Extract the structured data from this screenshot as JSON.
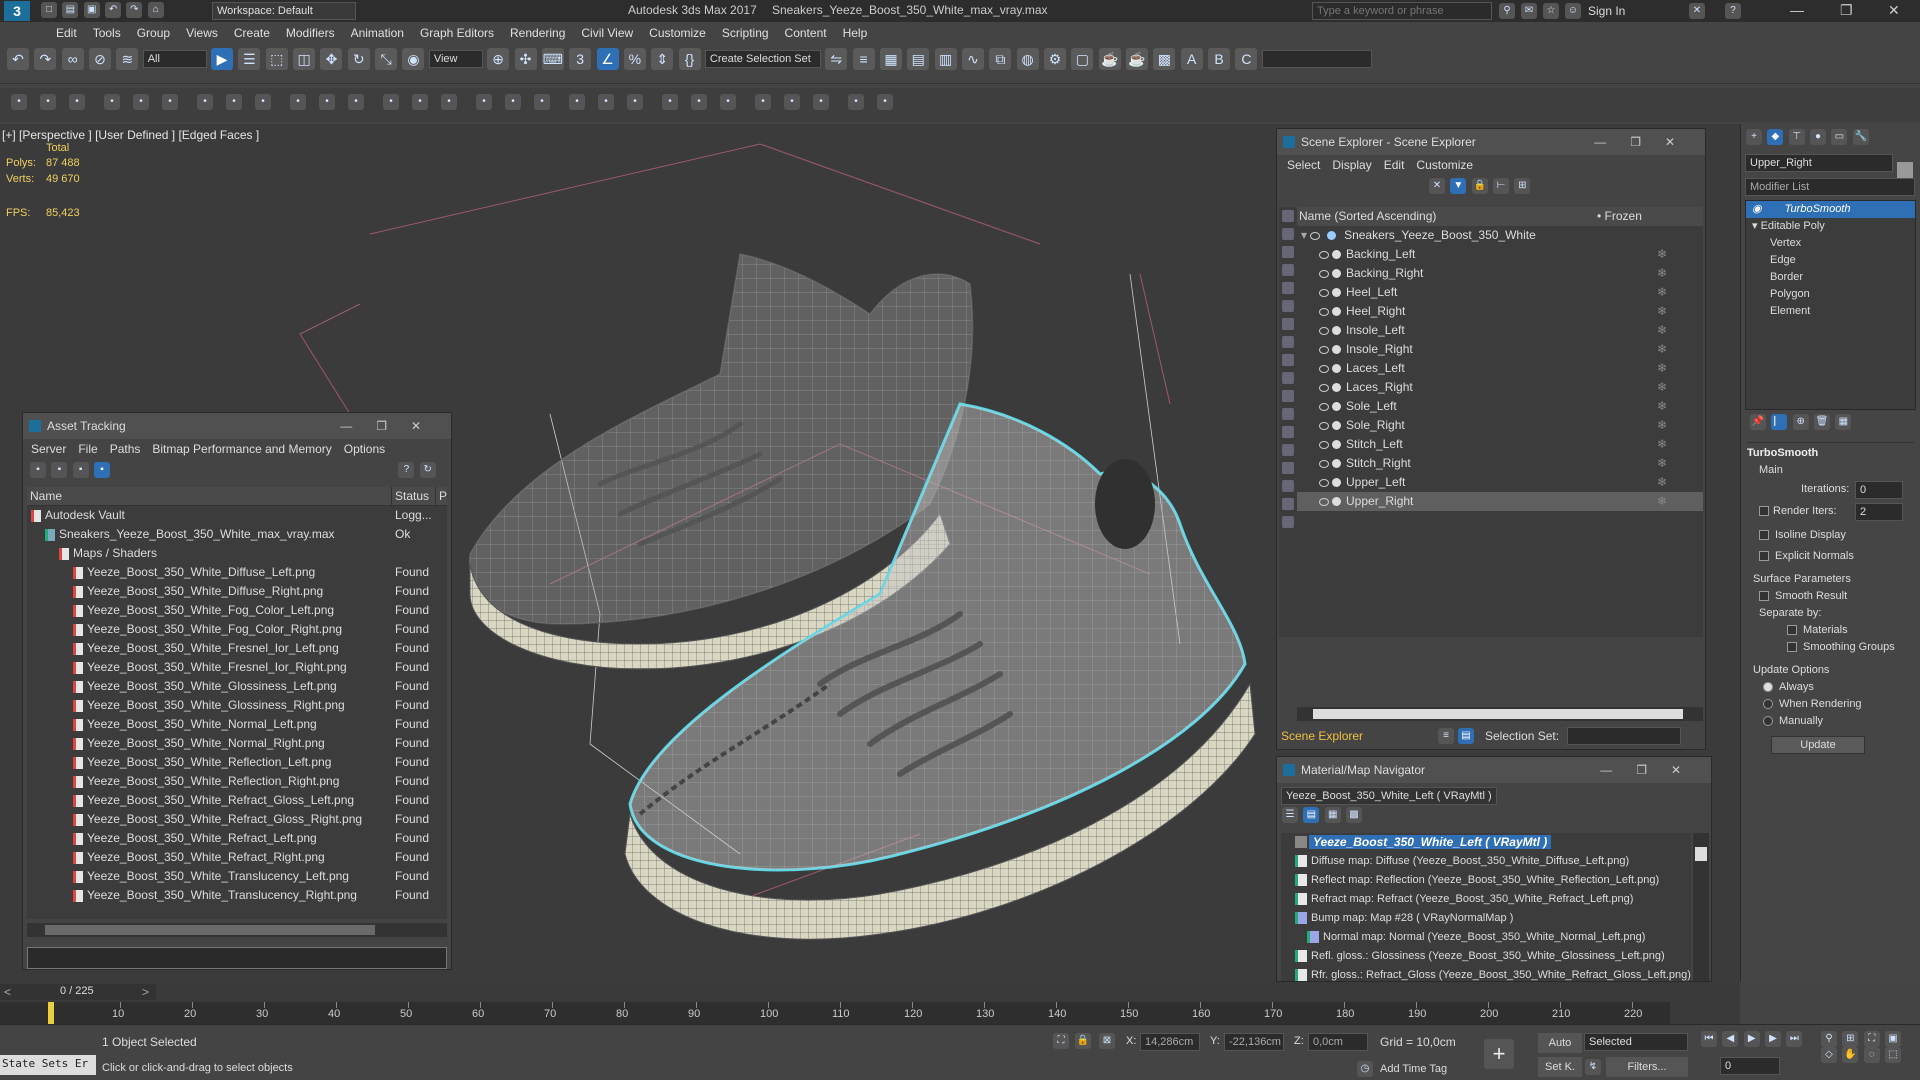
{
  "app": {
    "title": "Autodesk 3ds Max 2017",
    "document": "Sneakers_Yeeze_Boost_350_White_max_vray.max",
    "workspace": "Workspace: Default",
    "search_placeholder": "Type a keyword or phrase",
    "sign_in": "Sign In"
  },
  "menu": [
    "Edit",
    "Tools",
    "Group",
    "Views",
    "Create",
    "Modifiers",
    "Animation",
    "Graph Editors",
    "Rendering",
    "Civil View",
    "Customize",
    "Scripting",
    "Content",
    "Help"
  ],
  "toolbar": {
    "filter_all": "All",
    "view_dropdown": "View",
    "selection_set": "Create Selection Set"
  },
  "viewport": {
    "label_plus": "[+]",
    "label_view": "[Perspective ]",
    "label_shading": "[User Defined ]",
    "label_faces": "[Edged Faces ]",
    "stats_total": "Total",
    "polys_label": "Polys:",
    "polys_value": "87 488",
    "verts_label": "Verts:",
    "verts_value": "49 670",
    "fps_label": "FPS:",
    "fps_value": "85,423"
  },
  "asset_tracking": {
    "title": "Asset Tracking",
    "menu": [
      "Server",
      "File",
      "Paths",
      "Bitmap Performance and Memory",
      "Options"
    ],
    "col_name": "Name",
    "col_status": "Status",
    "col_extra": "Pr",
    "rows": [
      {
        "name": "Autodesk Vault",
        "status": "Logg...",
        "indent": 0
      },
      {
        "name": "Sneakers_Yeeze_Boost_350_White_max_vray.max",
        "status": "Ok",
        "indent": 1
      },
      {
        "name": "Maps / Shaders",
        "status": "",
        "indent": 2
      },
      {
        "name": "Yeeze_Boost_350_White_Diffuse_Left.png",
        "status": "Found",
        "indent": 3
      },
      {
        "name": "Yeeze_Boost_350_White_Diffuse_Right.png",
        "status": "Found",
        "indent": 3
      },
      {
        "name": "Yeeze_Boost_350_White_Fog_Color_Left.png",
        "status": "Found",
        "indent": 3
      },
      {
        "name": "Yeeze_Boost_350_White_Fog_Color_Right.png",
        "status": "Found",
        "indent": 3
      },
      {
        "name": "Yeeze_Boost_350_White_Fresnel_Ior_Left.png",
        "status": "Found",
        "indent": 3
      },
      {
        "name": "Yeeze_Boost_350_White_Fresnel_Ior_Right.png",
        "status": "Found",
        "indent": 3
      },
      {
        "name": "Yeeze_Boost_350_White_Glossiness_Left.png",
        "status": "Found",
        "indent": 3
      },
      {
        "name": "Yeeze_Boost_350_White_Glossiness_Right.png",
        "status": "Found",
        "indent": 3
      },
      {
        "name": "Yeeze_Boost_350_White_Normal_Left.png",
        "status": "Found",
        "indent": 3
      },
      {
        "name": "Yeeze_Boost_350_White_Normal_Right.png",
        "status": "Found",
        "indent": 3
      },
      {
        "name": "Yeeze_Boost_350_White_Reflection_Left.png",
        "status": "Found",
        "indent": 3
      },
      {
        "name": "Yeeze_Boost_350_White_Reflection_Right.png",
        "status": "Found",
        "indent": 3
      },
      {
        "name": "Yeeze_Boost_350_White_Refract_Gloss_Left.png",
        "status": "Found",
        "indent": 3
      },
      {
        "name": "Yeeze_Boost_350_White_Refract_Gloss_Right.png",
        "status": "Found",
        "indent": 3
      },
      {
        "name": "Yeeze_Boost_350_White_Refract_Left.png",
        "status": "Found",
        "indent": 3
      },
      {
        "name": "Yeeze_Boost_350_White_Refract_Right.png",
        "status": "Found",
        "indent": 3
      },
      {
        "name": "Yeeze_Boost_350_White_Translucency_Left.png",
        "status": "Found",
        "indent": 3
      },
      {
        "name": "Yeeze_Boost_350_White_Translucency_Right.png",
        "status": "Found",
        "indent": 3
      }
    ]
  },
  "scene_explorer": {
    "title": "Scene Explorer - Scene Explorer",
    "menu": [
      "Select",
      "Display",
      "Edit",
      "Customize"
    ],
    "col_name": "Name (Sorted Ascending)",
    "col_frozen": "• Frozen",
    "root": "Sneakers_Yeeze_Boost_350_White",
    "items": [
      "Backing_Left",
      "Backing_Right",
      "Heel_Left",
      "Heel_Right",
      "Insole_Left",
      "Insole_Right",
      "Laces_Left",
      "Laces_Right",
      "Sole_Left",
      "Sole_Right",
      "Stitch_Left",
      "Stitch_Right",
      "Upper_Left",
      "Upper_Right"
    ],
    "footer_label": "Scene Explorer",
    "selection_set_label": "Selection Set:"
  },
  "material_navigator": {
    "title": "Material/Map Navigator",
    "current": "Yeeze_Boost_350_White_Left  ( VRayMtl )",
    "root": "Yeeze_Boost_350_White_Left  ( VRayMtl )",
    "items": [
      "Diffuse map: Diffuse (Yeeze_Boost_350_White_Diffuse_Left.png)",
      "Reflect map: Reflection (Yeeze_Boost_350_White_Reflection_Left.png)",
      "Refract map: Refract (Yeeze_Boost_350_White_Refract_Left.png)",
      "Bump map: Map #28  ( VRayNormalMap )",
      "Normal map: Normal (Yeeze_Boost_350_White_Normal_Left.png)",
      "Refl. gloss.: Glossiness (Yeeze_Boost_350_White_Glossiness_Left.png)",
      "Rfr. gloss.: Refract_Gloss (Yeeze_Boost_350_White_Refract_Gloss_Left.png)"
    ]
  },
  "command_panel": {
    "object_name": "Upper_Right",
    "modifier_list": "Modifier List",
    "stack": [
      "TurboSmooth",
      "Editable Poly",
      "Vertex",
      "Edge",
      "Border",
      "Polygon",
      "Element"
    ],
    "rollout_title": "TurboSmooth",
    "main": "Main",
    "iterations_label": "Iterations:",
    "iterations_value": "0",
    "render_iters_label": "Render Iters:",
    "render_iters_value": "2",
    "isoline": "Isoline Display",
    "explicit_normals": "Explicit Normals",
    "surface_params": "Surface Parameters",
    "smooth_result": "Smooth Result",
    "separate_by": "Separate by:",
    "materials": "Materials",
    "smoothing_groups": "Smoothing Groups",
    "update_options": "Update Options",
    "always": "Always",
    "when_rendering": "When Rendering",
    "manually": "Manually",
    "update_button": "Update"
  },
  "timeline": {
    "frame": "0 / 225",
    "ticks": [
      "10",
      "20",
      "30",
      "40",
      "50",
      "60",
      "70",
      "80",
      "90",
      "100",
      "110",
      "120",
      "130",
      "140",
      "150",
      "160",
      "170",
      "180",
      "190",
      "200",
      "210",
      "220"
    ]
  },
  "statusbar": {
    "state_sets": "State Sets Er",
    "selected": "1 Object Selected",
    "hint": "Click or click-and-drag to select objects",
    "x_label": "X:",
    "x_value": "14,286cm",
    "y_label": "Y:",
    "y_value": "-22,136cm",
    "z_label": "Z:",
    "z_value": "0,0cm",
    "grid": "Grid = 10,0cm",
    "add_time_tag": "Add Time Tag",
    "auto": "Auto",
    "selected_dropdown": "Selected",
    "set_k": "Set K.",
    "filters": "Filters...",
    "frame_value": "0"
  },
  "colors": {
    "accent": "#2f6fb5",
    "selection_outline": "#5ad8e8",
    "stats": "#f0d060"
  }
}
